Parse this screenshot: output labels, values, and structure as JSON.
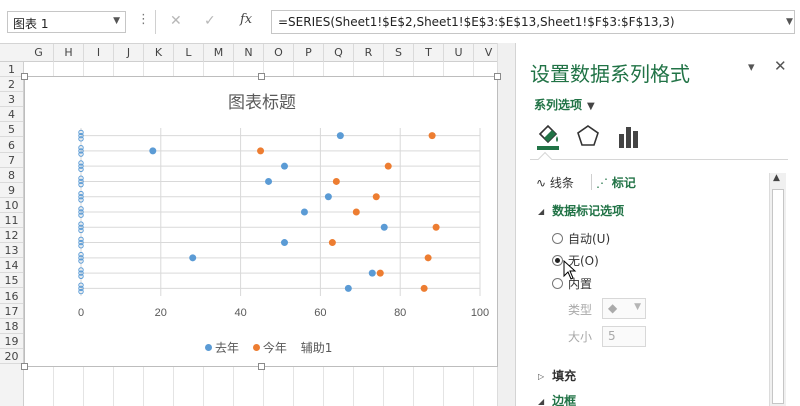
{
  "formula_bar": {
    "name_box": "图表 1",
    "fx_label": "fx",
    "formula": "=SERIES(Sheet1!$E$2,Sheet1!$E$3:$E$13,Sheet1!$F$3:$F$13,3)",
    "cancel_icon": "x-icon",
    "confirm_icon": "check-icon"
  },
  "columns": [
    "G",
    "H",
    "I",
    "J",
    "K",
    "L",
    "M",
    "N",
    "O",
    "P",
    "Q",
    "R",
    "S",
    "T",
    "U",
    "V"
  ],
  "rows": [
    "1",
    "2",
    "3",
    "4",
    "5",
    "6",
    "7",
    "8",
    "9",
    "10",
    "11",
    "12",
    "13",
    "14",
    "15",
    "16",
    "17",
    "18",
    "19",
    "20"
  ],
  "chart": {
    "title": "图表标题",
    "legend": [
      "去年",
      "今年",
      "辅助1"
    ],
    "colors": {
      "last_year": "#5B9BD5",
      "this_year": "#ED7D31",
      "helper": "#5B9BD5"
    }
  },
  "chart_data": {
    "type": "scatter",
    "title": "图表标题",
    "xlabel": "",
    "ylabel": "",
    "xlim": [
      0,
      100
    ],
    "xticks": [
      0,
      20,
      40,
      60,
      80,
      100
    ],
    "ylim": [
      0.5,
      11.5
    ],
    "grid": true,
    "legend_position": "bottom",
    "series": [
      {
        "name": "去年",
        "x": [
          65,
          18,
          51,
          47,
          62,
          56,
          76,
          51,
          28,
          73,
          67
        ],
        "y": [
          11,
          10,
          9,
          8,
          7,
          6,
          5,
          4,
          3,
          2,
          1
        ]
      },
      {
        "name": "今年",
        "x": [
          88,
          45,
          77,
          64,
          74,
          69,
          89,
          63,
          87,
          75,
          86
        ],
        "y": [
          11,
          10,
          9,
          8,
          7,
          6,
          5,
          4,
          3,
          2,
          1
        ]
      },
      {
        "name": "辅助1",
        "x": [
          0,
          0,
          0,
          0,
          0,
          0,
          0,
          0,
          0,
          0,
          0
        ],
        "y": [
          11,
          10,
          9,
          8,
          7,
          6,
          5,
          4,
          3,
          2,
          1
        ]
      }
    ]
  },
  "pane": {
    "title": "设置数据系列格式",
    "series_options": "系列选项",
    "tab_line": "线条",
    "tab_marker": "标记",
    "section_marker_options": "数据标记选项",
    "radio_auto": "自动(U)",
    "radio_none": "无(O)",
    "radio_builtin": "内置",
    "label_type": "类型",
    "label_size": "大小",
    "size_value": "5",
    "section_fill": "填充",
    "section_border": "边框"
  }
}
